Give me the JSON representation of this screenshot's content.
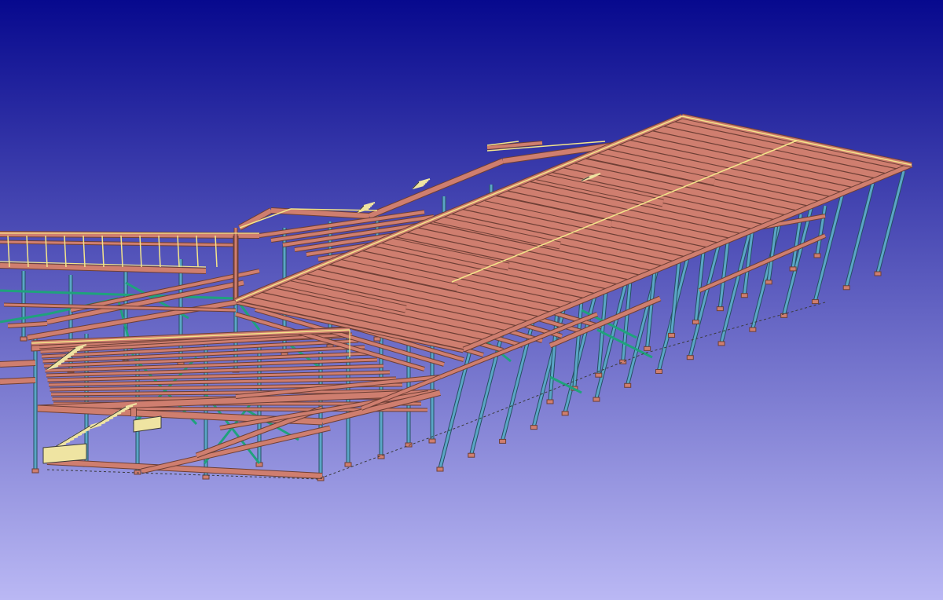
{
  "viewport": {
    "background_top": "#07098e",
    "background_bottom": "#bab8f4"
  },
  "model": {
    "kind": "3d-steel-structure-wireframe",
    "colors": {
      "beam": "#cf7e6f",
      "beam_edge": "#6e3f35",
      "column": "#5aa6c6",
      "column_edge": "#264f62",
      "brace": "#1fa27c",
      "outline": "#f3e58a",
      "stair": "#efe4a2",
      "outline_dark": "#3a3a3a"
    }
  }
}
